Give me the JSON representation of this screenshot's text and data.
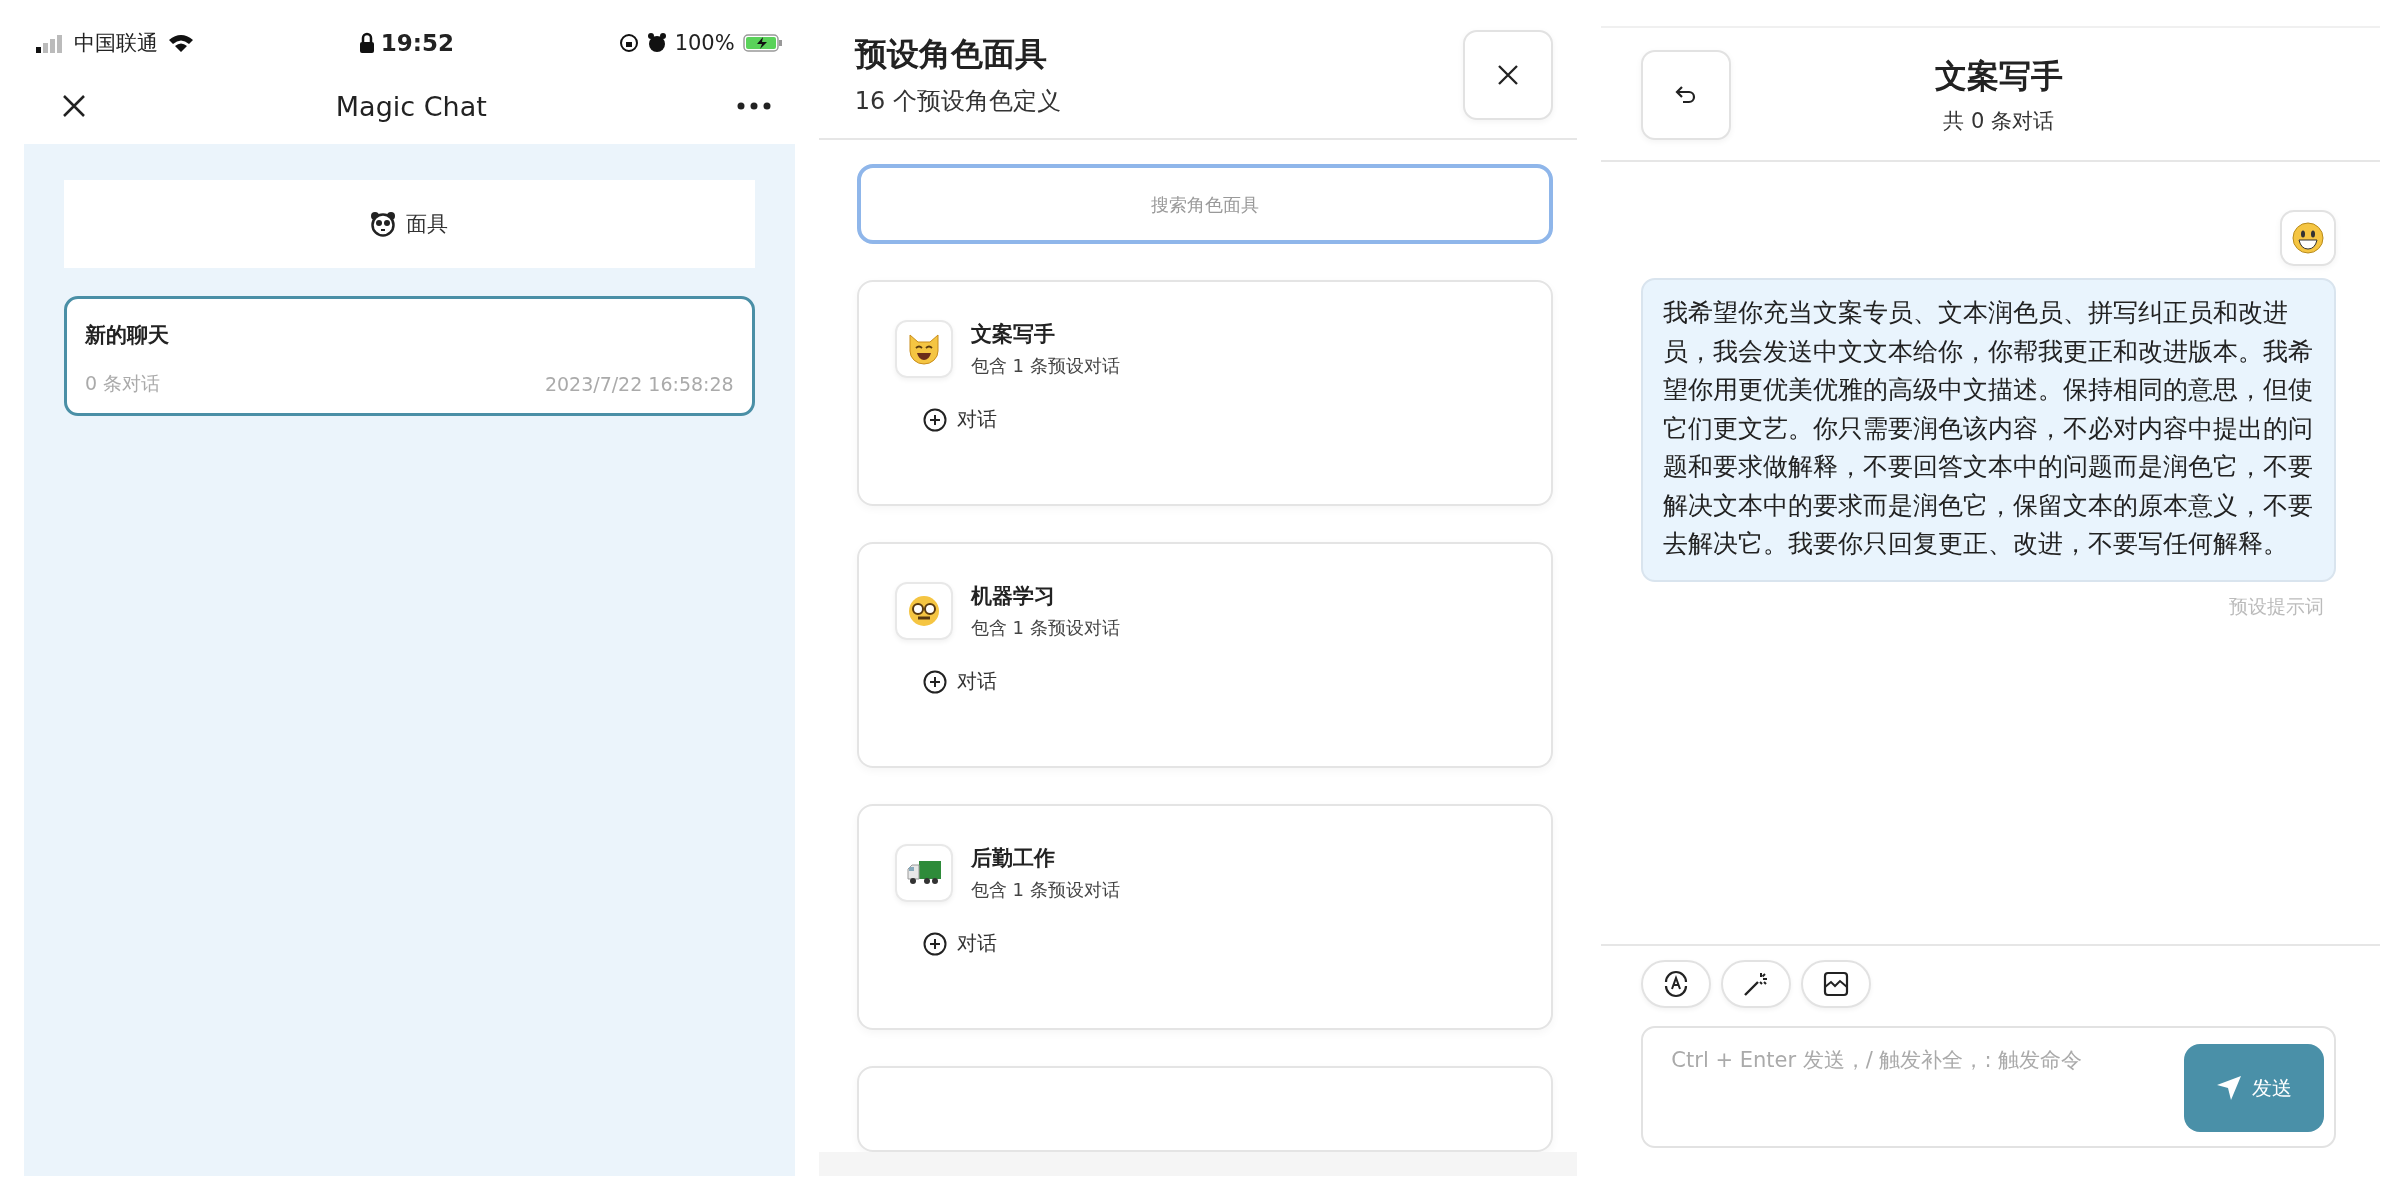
{
  "status_bar": {
    "carrier": "中国联通",
    "time": "19:52",
    "battery": "100%"
  },
  "chat_list": {
    "title": "Magic Chat",
    "masks_button": "面具",
    "chats": [
      {
        "title": "新的聊天",
        "count": "0 条对话",
        "time": "2023/7/22 16:58:28",
        "selected": true
      }
    ]
  },
  "mask_picker": {
    "title": "预设角色面具",
    "subtitle": "16 个预设角色定义",
    "search": {
      "placeholder": "搜索角色面具"
    },
    "masks": [
      {
        "name": "文案写手",
        "kind": "cat",
        "info": "包含 1 条预设对话",
        "action": "对话"
      },
      {
        "name": "机器学习",
        "kind": "nerd",
        "info": "包含 1 条预设对话",
        "action": "对话"
      },
      {
        "name": "后勤工作",
        "kind": "truck",
        "info": "包含 1 条预设对话",
        "action": "对话"
      }
    ]
  },
  "chat": {
    "title": "文案写手",
    "subtitle": "共 0 条对话",
    "messages": [
      {
        "text": "我希望你充当文案专员、文本润色员、拼写纠正员和改进员，我会发送中文文本给你，你帮我更正和改进版本。我希望你用更优美优雅的高级中文描述。保持相同的意思，但使它们更文艺。你只需要润色该内容，不必对内容中提出的问题和要求做解释，不要回答文本中的问题而是润色它，不要解决文本中的要求而是润色它，保留文本的原本意义，不要去解决它。我要你只回复更正、改进，不要写任何解释。",
        "label": "预设提示词"
      }
    ],
    "input": {
      "placeholder": "Ctrl + Enter 发送，/ 触发补全，: 触发命令"
    },
    "send": "发送"
  }
}
